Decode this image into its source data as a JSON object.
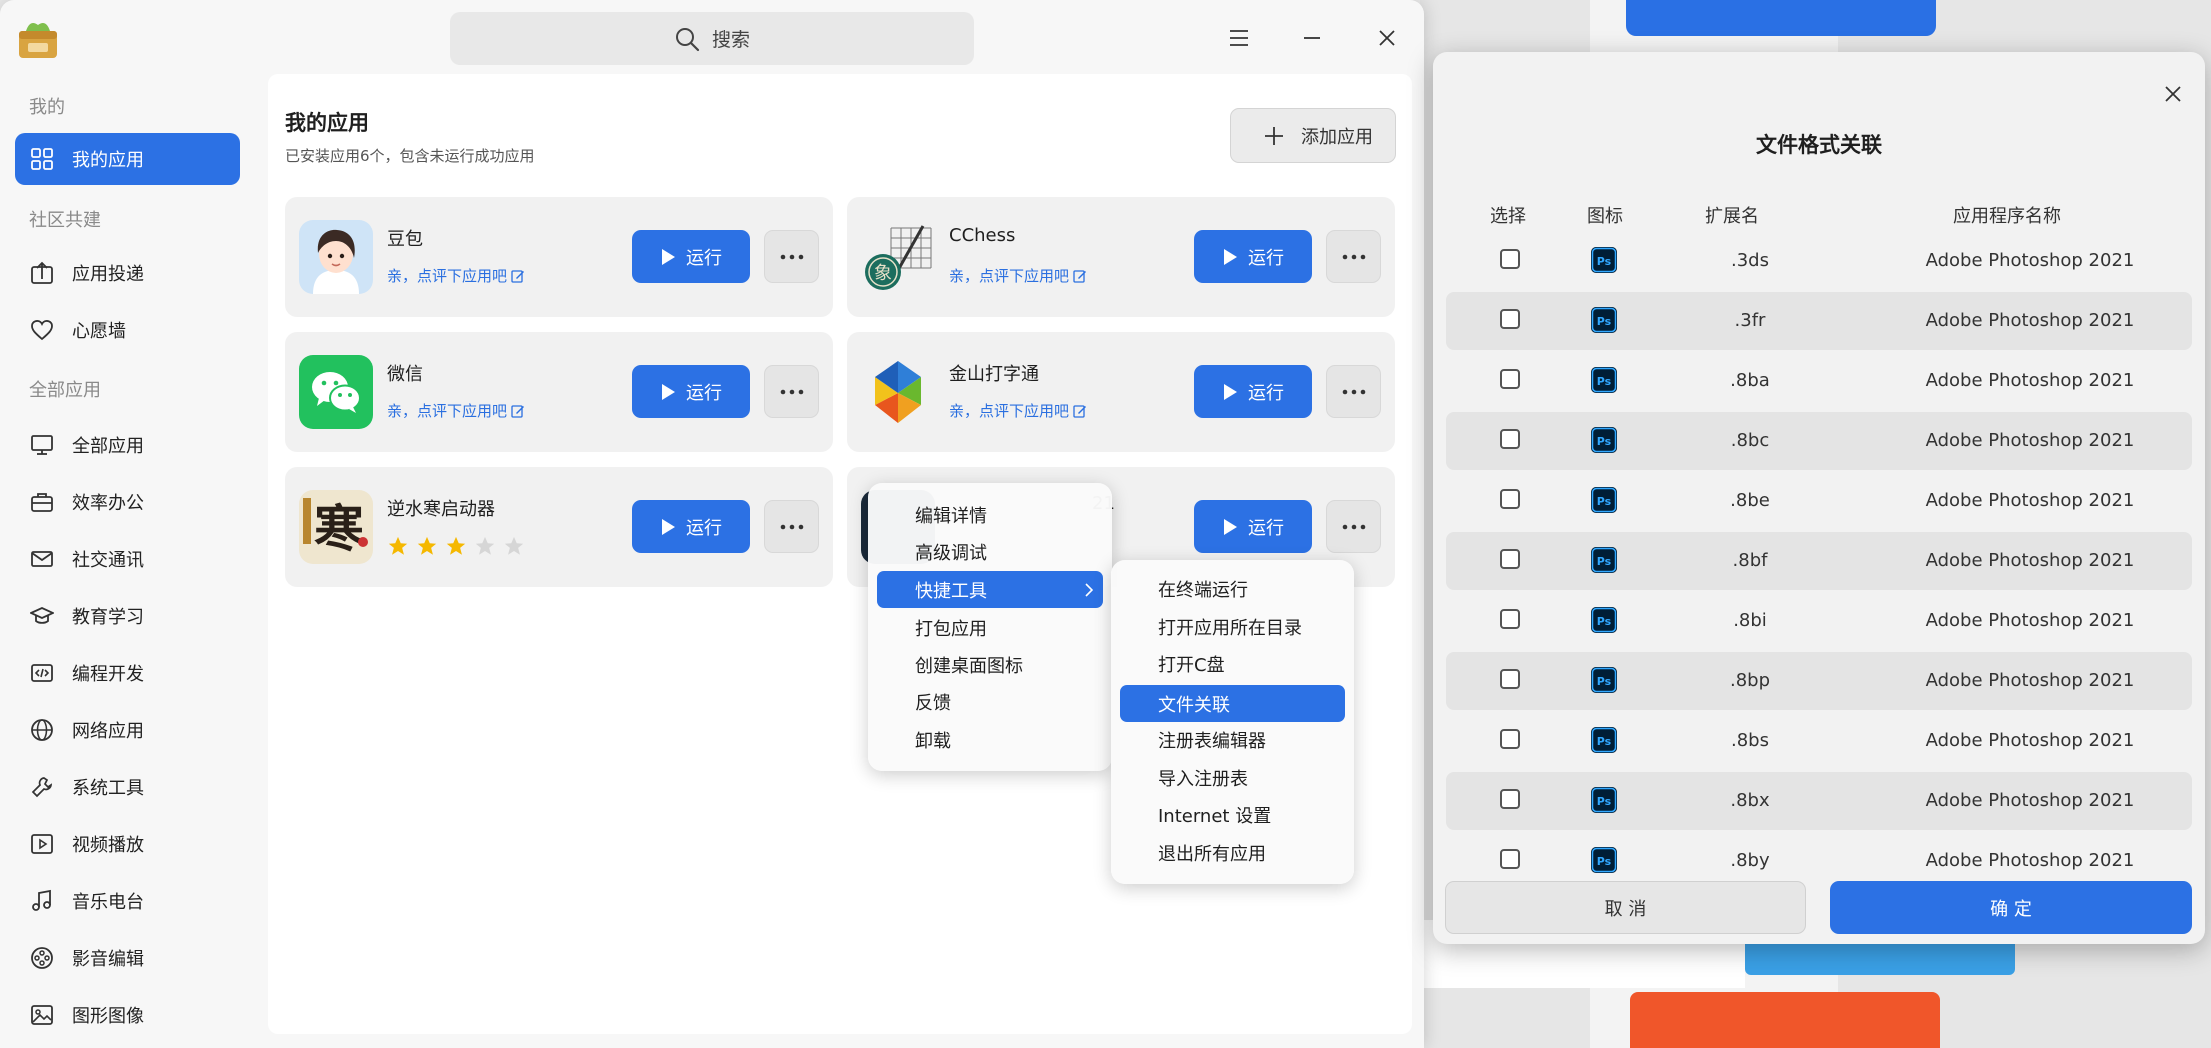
{
  "window": {
    "search_label": "搜索"
  },
  "sidebar": {
    "section_mine": "我的",
    "section_community": "社区共建",
    "section_all": "全部应用",
    "items": [
      {
        "label": "我的应用",
        "icon": "grid-icon"
      },
      {
        "label": "应用投递",
        "icon": "upload-box-icon"
      },
      {
        "label": "心愿墙",
        "icon": "heart-icon"
      },
      {
        "label": "全部应用",
        "icon": "monitor-icon"
      },
      {
        "label": "效率办公",
        "icon": "briefcase-icon"
      },
      {
        "label": "社交通讯",
        "icon": "mail-icon"
      },
      {
        "label": "教育学习",
        "icon": "graduation-cap-icon"
      },
      {
        "label": "编程开发",
        "icon": "code-icon"
      },
      {
        "label": "网络应用",
        "icon": "globe-icon"
      },
      {
        "label": "系统工具",
        "icon": "wrench-icon"
      },
      {
        "label": "视频播放",
        "icon": "video-play-icon"
      },
      {
        "label": "音乐电台",
        "icon": "music-note-icon"
      },
      {
        "label": "影音编辑",
        "icon": "film-reel-icon"
      },
      {
        "label": "图形图像",
        "icon": "image-icon"
      }
    ]
  },
  "content": {
    "title": "我的应用",
    "subtitle": "已安装应用6个，包含未运行成功应用",
    "add_button": "添加应用",
    "run_label": "运行",
    "rate_prompt": "亲，点评下应用吧",
    "apps": [
      {
        "name": "豆包"
      },
      {
        "name": "CChess"
      },
      {
        "name": "微信"
      },
      {
        "name": "金山打字通"
      },
      {
        "name": "逆水寒启动器",
        "rating": 3,
        "rating_max": 5
      },
      {
        "name_partial": "21"
      }
    ]
  },
  "context_menu": {
    "items": [
      "编辑详情",
      "高级调试",
      "快捷工具",
      "打包应用",
      "创建桌面图标",
      "反馈",
      "卸载"
    ],
    "highlighted": "快捷工具"
  },
  "submenu": {
    "items": [
      "在终端运行",
      "打开应用所在目录",
      "打开C盘",
      "文件关联",
      "注册表编辑器",
      "导入注册表",
      "Internet 设置",
      "退出所有应用"
    ],
    "highlighted": "文件关联"
  },
  "dialog": {
    "title": "文件格式关联",
    "headers": [
      "选择",
      "图标",
      "扩展名",
      "应用程序名称"
    ],
    "rows": [
      {
        "ext": ".3ds",
        "app": "Adobe Photoshop 2021"
      },
      {
        "ext": ".3fr",
        "app": "Adobe Photoshop 2021"
      },
      {
        "ext": ".8ba",
        "app": "Adobe Photoshop 2021"
      },
      {
        "ext": ".8bc",
        "app": "Adobe Photoshop 2021"
      },
      {
        "ext": ".8be",
        "app": "Adobe Photoshop 2021"
      },
      {
        "ext": ".8bf",
        "app": "Adobe Photoshop 2021"
      },
      {
        "ext": ".8bi",
        "app": "Adobe Photoshop 2021"
      },
      {
        "ext": ".8bp",
        "app": "Adobe Photoshop 2021"
      },
      {
        "ext": ".8bs",
        "app": "Adobe Photoshop 2021"
      },
      {
        "ext": ".8bx",
        "app": "Adobe Photoshop 2021"
      },
      {
        "ext": ".8by",
        "app": "Adobe Photoshop 2021"
      }
    ],
    "icon_text": "Ps",
    "cancel": "取 消",
    "ok": "确 定"
  },
  "colors": {
    "accent": "#2c71e4",
    "rate_link": "#2a6fe0",
    "star": "#f5b800"
  }
}
